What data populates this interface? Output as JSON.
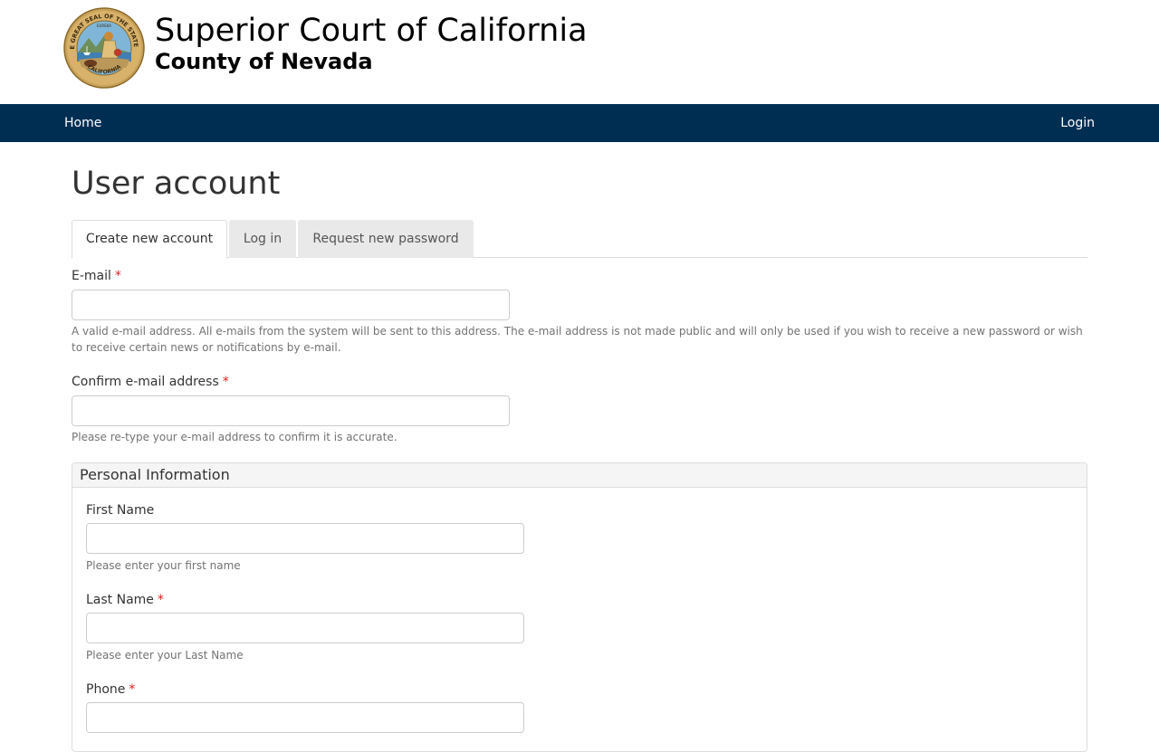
{
  "header": {
    "site_name": "Superior Court of California",
    "site_slogan": "County of Nevada",
    "seal_text_top": "THE GREAT SEAL OF THE STATE OF",
    "seal_text_bottom": "CALIFORNIA",
    "seal_motto": "EUREKA"
  },
  "nav": {
    "home": "Home",
    "login": "Login"
  },
  "page": {
    "title": "User account"
  },
  "tabs": [
    {
      "label": "Create new account",
      "active": true
    },
    {
      "label": "Log in",
      "active": false
    },
    {
      "label": "Request new password",
      "active": false
    }
  ],
  "form": {
    "required_marker": "*",
    "email": {
      "label": "E-mail",
      "value": "",
      "help": "A valid e-mail address. All e-mails from the system will be sent to this address. The e-mail address is not made public and will only be used if you wish to receive a new password or wish to receive certain news or notifications by e-mail."
    },
    "confirm_email": {
      "label": "Confirm e-mail address",
      "value": "",
      "help": "Please re-type your e-mail address to confirm it is accurate."
    },
    "personal_info": {
      "legend": "Personal Information",
      "first_name": {
        "label": "First Name",
        "value": "",
        "help": "Please enter your first name"
      },
      "last_name": {
        "label": "Last Name",
        "value": "",
        "help": "Please enter your Last Name"
      },
      "phone": {
        "label": "Phone",
        "value": ""
      }
    }
  },
  "colors": {
    "navbar": "#002e52",
    "required": "#e02020",
    "tab_inactive": "#e9e9e9"
  }
}
